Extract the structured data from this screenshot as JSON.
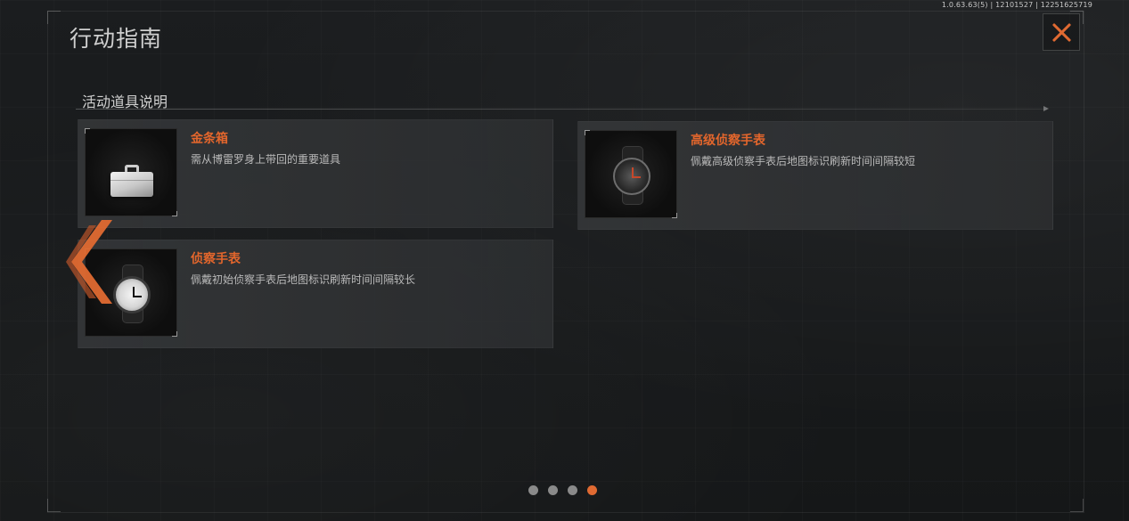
{
  "version": "1.0.63.63(5) | 12101527 | 12251625719",
  "header": {
    "title": "行动指南"
  },
  "section": {
    "title": "活动道具说明"
  },
  "items": [
    {
      "name": "金条箱",
      "description": "需从博雷罗身上带回的重要道具",
      "icon": "briefcase-icon"
    },
    {
      "name": "高级侦察手表",
      "description": "佩戴高级侦察手表后地图标识刷新时间间隔较短",
      "icon": "watch-icon"
    },
    {
      "name": "侦察手表",
      "description": "佩戴初始侦察手表后地图标识刷新时间间隔较长",
      "icon": "watch-icon"
    }
  ],
  "pagination": {
    "total": 4,
    "current": 4
  },
  "colors": {
    "accent": "#e06a32",
    "item_name": "#e3662c",
    "background": "#17191b"
  }
}
